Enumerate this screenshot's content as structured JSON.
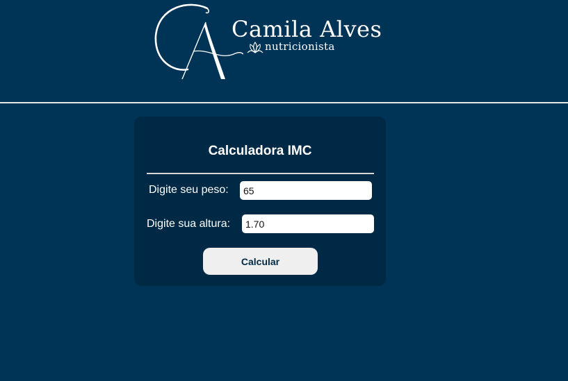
{
  "brand": {
    "monogram": "CA",
    "name": "Camila Alves",
    "tagline": "nutricionista"
  },
  "calculator": {
    "title": "Calculadora IMC",
    "weight": {
      "label": "Digite seu peso:",
      "value": "65"
    },
    "height": {
      "label": "Digite sua altura:",
      "value": "1.70"
    },
    "submit_label": "Calcular"
  },
  "colors": {
    "page_background": "#003456",
    "card_background": "#002945",
    "button_background": "#efefef",
    "button_text": "#002945"
  }
}
